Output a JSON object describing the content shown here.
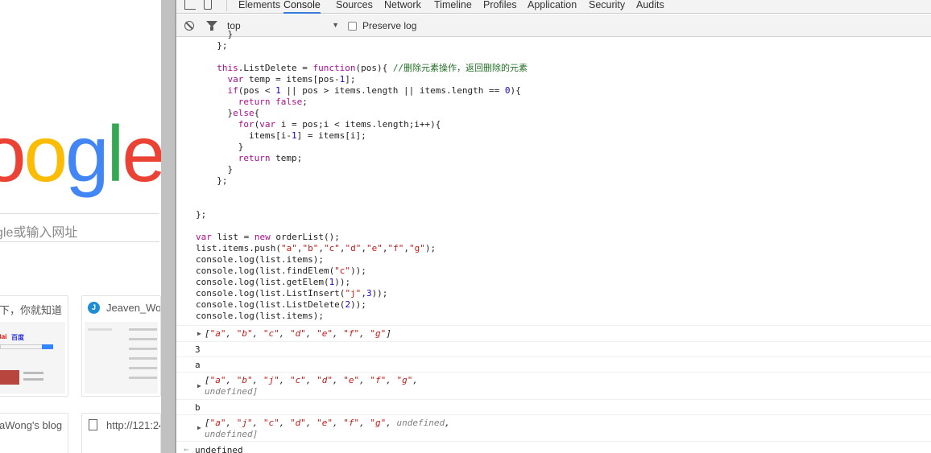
{
  "left_page": {
    "logo": [
      {
        "ch": "o",
        "color": "#ea4335"
      },
      {
        "ch": "o",
        "color": "#fbbc05"
      },
      {
        "ch": "g",
        "color": "#4285f4"
      },
      {
        "ch": "l",
        "color": "#34a853"
      },
      {
        "ch": "e",
        "color": "#ea4335"
      }
    ],
    "search_placeholder": "gle或输入网址",
    "tiles": [
      {
        "title": "下，你就知道",
        "icon": "none"
      },
      {
        "title": "Jeaven_Wo",
        "icon": "jw-icon"
      },
      {
        "title": "aWong's blog",
        "icon": "none"
      },
      {
        "title": "http://121:24",
        "icon": "doc-icon"
      }
    ]
  },
  "devtools": {
    "tabs": [
      "Elements",
      "Console",
      "Sources",
      "Network",
      "Timeline",
      "Profiles",
      "Application",
      "Security",
      "Audits"
    ],
    "active_tab": "Console",
    "context": "top",
    "preserve_log": "Preserve log",
    "code_lines": [
      "    }",
      "  };",
      "",
      "  this.ListDelete = function(pos){ //删除元素操作，返回删除的元素",
      "    var temp = items[pos-1];",
      "    if(pos < 1 || pos > items.length || items.length == 0){",
      "      return false;",
      "    }else{",
      "      for(var i = pos;i < items.length;i++){",
      "        items[i-1] = items[i];",
      "      }",
      "      return temp;",
      "    }",
      "  };",
      "",
      "",
      "};",
      "",
      "var list = new orderList();",
      "list.items.push(\"a\",\"b\",\"c\",\"d\",\"e\",\"f\",\"g\");",
      "console.log(list.items);",
      "console.log(list.findElem(\"c\"));",
      "console.log(list.getElem(1));",
      "console.log(list.ListInsert(\"j\",3));",
      "console.log(list.ListDelete(2));",
      "console.log(list.items);"
    ],
    "outputs": {
      "out1": "[\"a\", \"b\", \"c\", \"d\", \"e\", \"f\", \"g\"]",
      "out2": "3",
      "out3": "a",
      "out4_line1": "[\"a\", \"b\", \"j\", \"c\", \"d\", \"e\", \"f\", \"g\",",
      "out4_line2": "undefined]",
      "out5": "b",
      "out6_line1": "[\"a\", \"j\", \"c\", \"d\", \"e\", \"f\", \"g\", undefined,",
      "out6_line2": "undefined]",
      "result": "undefined"
    }
  }
}
